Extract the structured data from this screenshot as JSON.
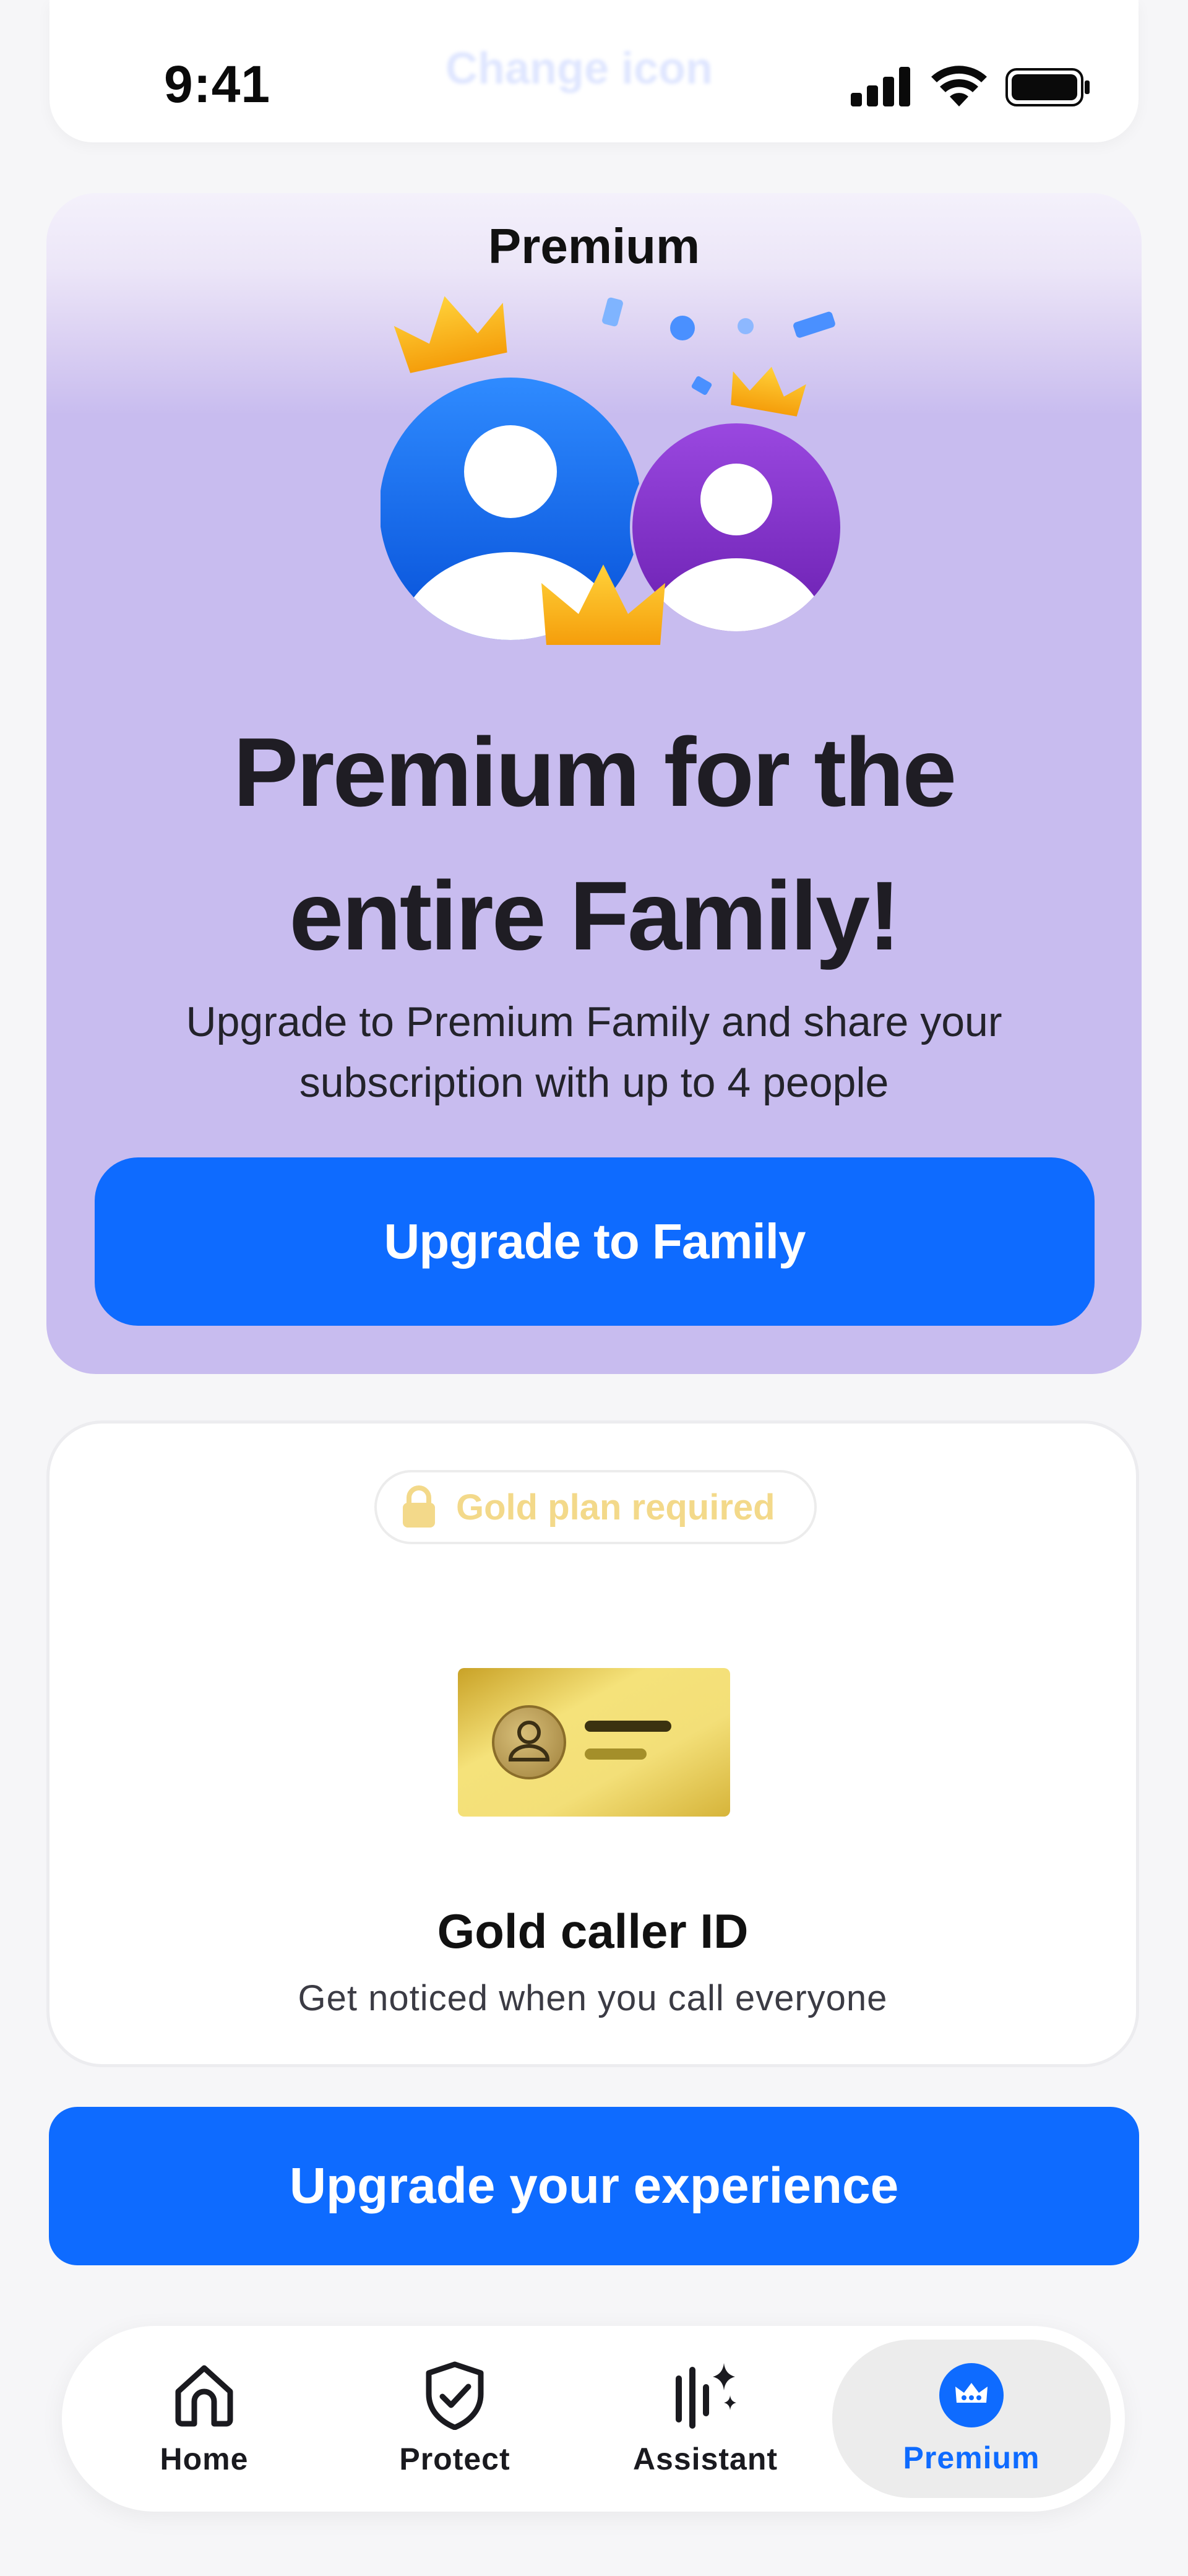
{
  "status_bar": {
    "time": "9:41",
    "ghost_title": "Change icon",
    "icons": [
      "signal-icon",
      "wifi-icon",
      "battery-icon"
    ]
  },
  "hero": {
    "title": "Premium",
    "heading_line1": "Premium for the",
    "heading_line2": "entire Family!",
    "subtitle_line1": "Upgrade to Premium Family and share your",
    "subtitle_line2": "subscription with up to 4 people",
    "button_label": "Upgrade to Family",
    "background_color": "#c8bcef"
  },
  "feature_card": {
    "badge_label": "Gold plan required",
    "title": "Gold caller ID",
    "subtitle": "Get noticed when you call everyone",
    "accent_color": "#f3d98a"
  },
  "upgrade_button": {
    "label": "Upgrade your experience",
    "color": "#0e6bff"
  },
  "tab_bar": {
    "items": [
      {
        "label": "Home",
        "icon": "home-icon",
        "active": false
      },
      {
        "label": "Protect",
        "icon": "shield-check-icon",
        "active": false
      },
      {
        "label": "Assistant",
        "icon": "assistant-sparkle-icon",
        "active": false
      },
      {
        "label": "Premium",
        "icon": "crown-icon",
        "active": true
      }
    ],
    "active_color": "#0e6bff"
  }
}
